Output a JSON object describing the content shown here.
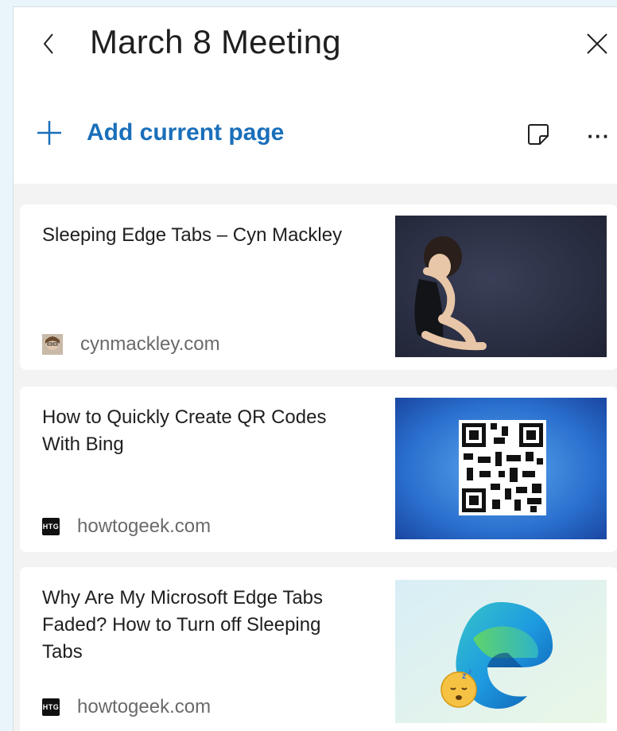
{
  "header": {
    "title": "March 8 Meeting",
    "back_icon": "chevron-left-icon",
    "close_icon": "close-icon"
  },
  "toolbar": {
    "add_label": "Add current page",
    "add_icon": "plus-icon",
    "note_icon": "sticky-note-icon",
    "more_icon": "more-horizontal-icon",
    "more_glyph": "···"
  },
  "colors": {
    "accent": "#1a6fba",
    "page_background": "#eaf4fb",
    "panel_background": "#f3f3f3",
    "card_background": "#ffffff"
  },
  "items": [
    {
      "title": "Sleeping Edge Tabs – Cyn Mackley",
      "domain": "cynmackley.com",
      "favicon": "avatar-favicon",
      "thumbnail": "sleeping-child-photo"
    },
    {
      "title": "How to Quickly Create QR Codes With Bing",
      "domain": "howtogeek.com",
      "favicon_text": "HTG",
      "thumbnail": "qr-code-image"
    },
    {
      "title": "Why Are My Microsoft Edge Tabs Faded? How to Turn off Sleeping Tabs",
      "domain": "howtogeek.com",
      "favicon_text": "HTG",
      "thumbnail": "edge-logo-sleeping-image"
    }
  ]
}
